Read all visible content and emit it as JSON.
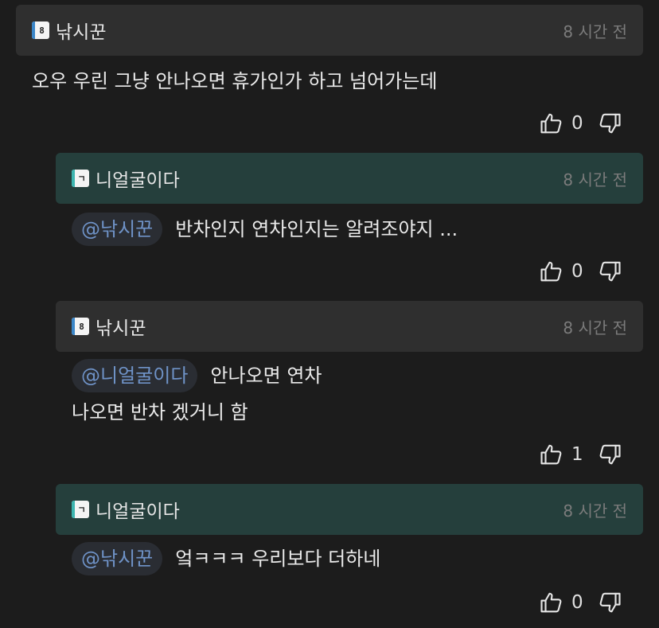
{
  "comments": [
    {
      "username": "낚시꾼",
      "badge_glyph": "8",
      "badge_color": "#3a86c8",
      "time": "8 시간 전",
      "header_style": "gray",
      "mention": "",
      "lines": [
        "오우 우린 그냥 안나오면 휴가인가 하고 넘어가는데"
      ],
      "likes": "0"
    },
    {
      "username": "니얼굴이다",
      "badge_glyph": "ㄱ",
      "badge_color": "#3db5b0",
      "time": "8 시간 전",
      "header_style": "teal",
      "mention": "@낚시꾼",
      "lines": [
        "반차인지 연차인지는 알려조야지 ..."
      ],
      "likes": "0"
    },
    {
      "username": "낚시꾼",
      "badge_glyph": "8",
      "badge_color": "#3a86c8",
      "time": "8 시간 전",
      "header_style": "gray",
      "mention": "@니얼굴이다",
      "lines": [
        "안나오면 연차",
        "나오면 반차 겠거니 함"
      ],
      "likes": "1"
    },
    {
      "username": "니얼굴이다",
      "badge_glyph": "ㄱ",
      "badge_color": "#3db5b0",
      "time": "8 시간 전",
      "header_style": "teal",
      "mention": "@낚시꾼",
      "lines": [
        "엌ㅋㅋㅋ 우리보다 더하네"
      ],
      "likes": "0"
    }
  ]
}
